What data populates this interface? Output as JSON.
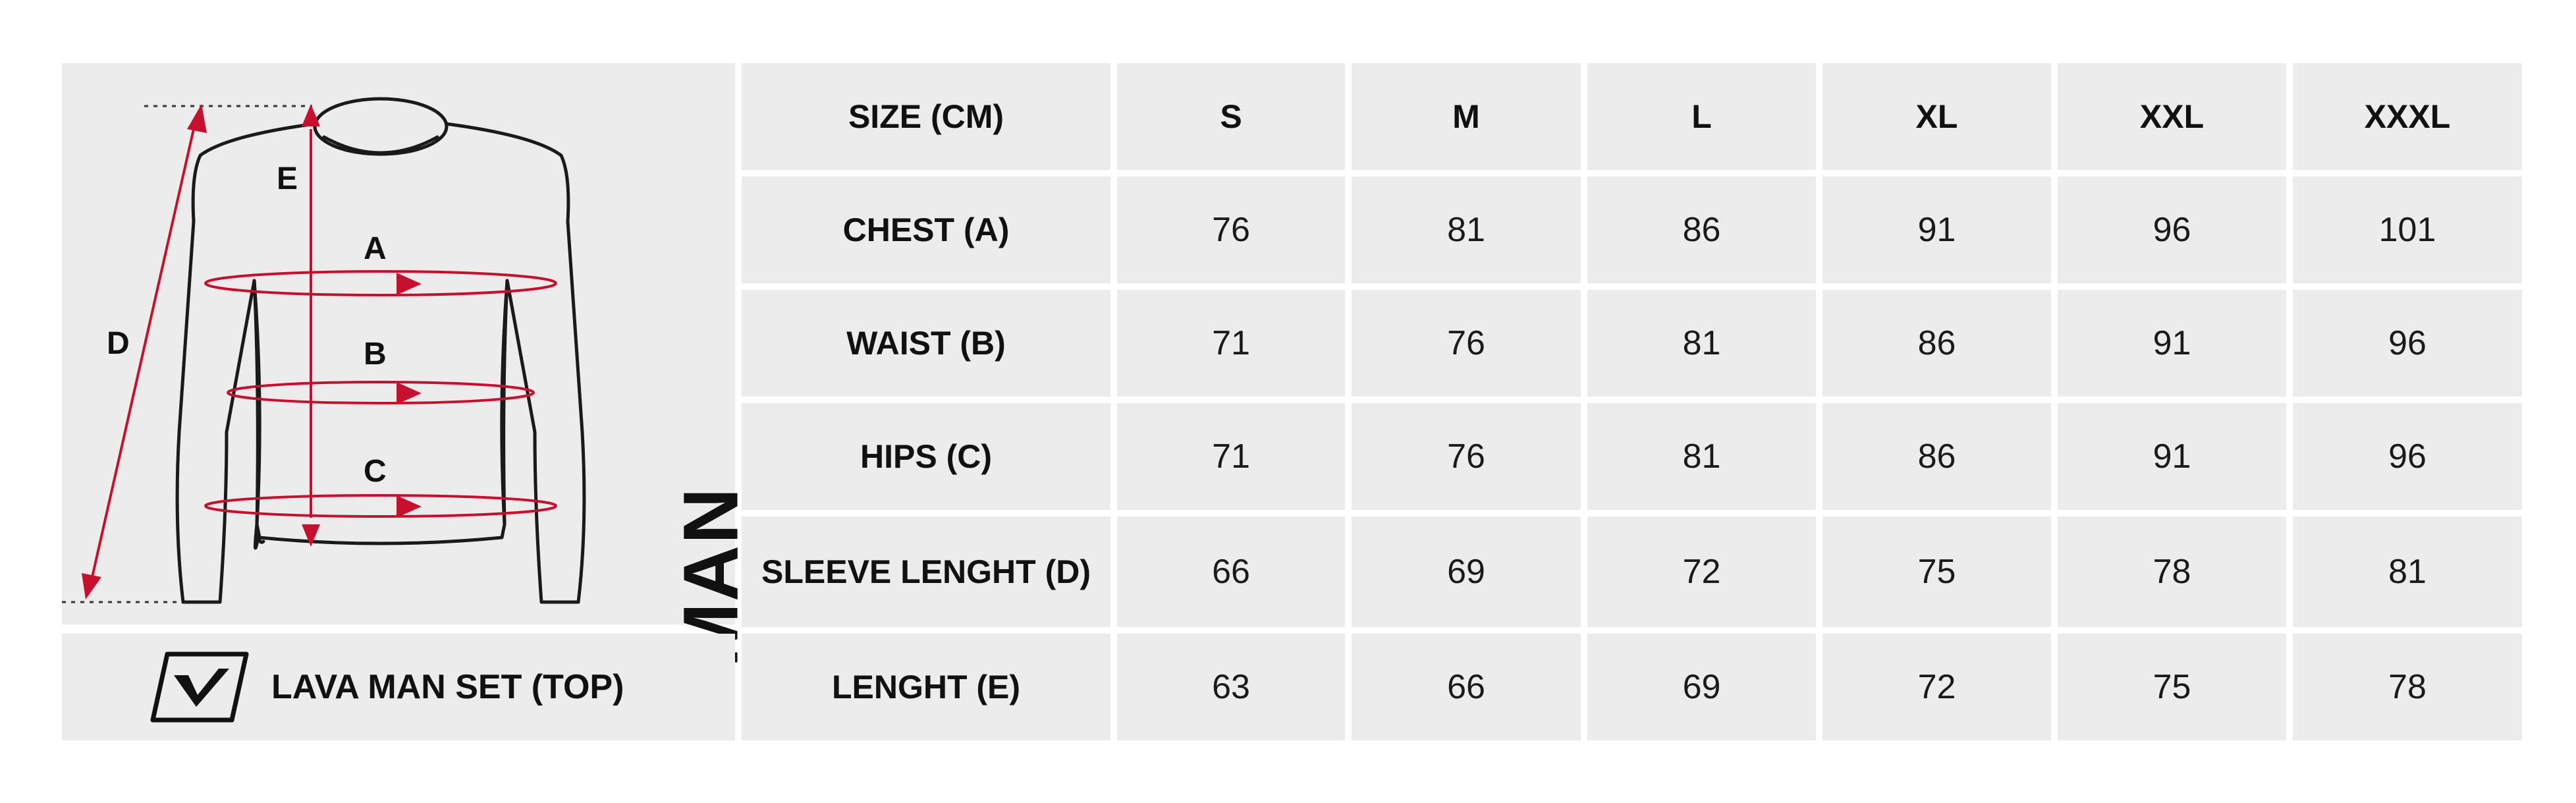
{
  "product": {
    "name": "LAVA MAN SET (TOP)",
    "gender_label": "MAN",
    "logo_icon": "lava-v-logo-icon"
  },
  "diagram": {
    "labels": {
      "a": "A",
      "b": "B",
      "c": "C",
      "d": "D",
      "e": "E"
    },
    "accent_color": "#c8102e"
  },
  "table": {
    "header": {
      "label": "SIZE (CM)",
      "sizes": [
        "S",
        "M",
        "L",
        "XL",
        "XXL",
        "XXXL"
      ]
    },
    "rows": [
      {
        "label": "CHEST (A)",
        "values": [
          "76",
          "81",
          "86",
          "91",
          "96",
          "101"
        ]
      },
      {
        "label": "WAIST (B)",
        "values": [
          "71",
          "76",
          "81",
          "86",
          "91",
          "96"
        ]
      },
      {
        "label": "HIPS (C)",
        "values": [
          "71",
          "76",
          "81",
          "86",
          "91",
          "96"
        ]
      },
      {
        "label": "SLEEVE LENGHT (D)",
        "values": [
          "66",
          "69",
          "72",
          "75",
          "78",
          "81"
        ]
      },
      {
        "label": "LENGHT (E)",
        "values": [
          "63",
          "66",
          "69",
          "72",
          "75",
          "78"
        ]
      }
    ]
  }
}
